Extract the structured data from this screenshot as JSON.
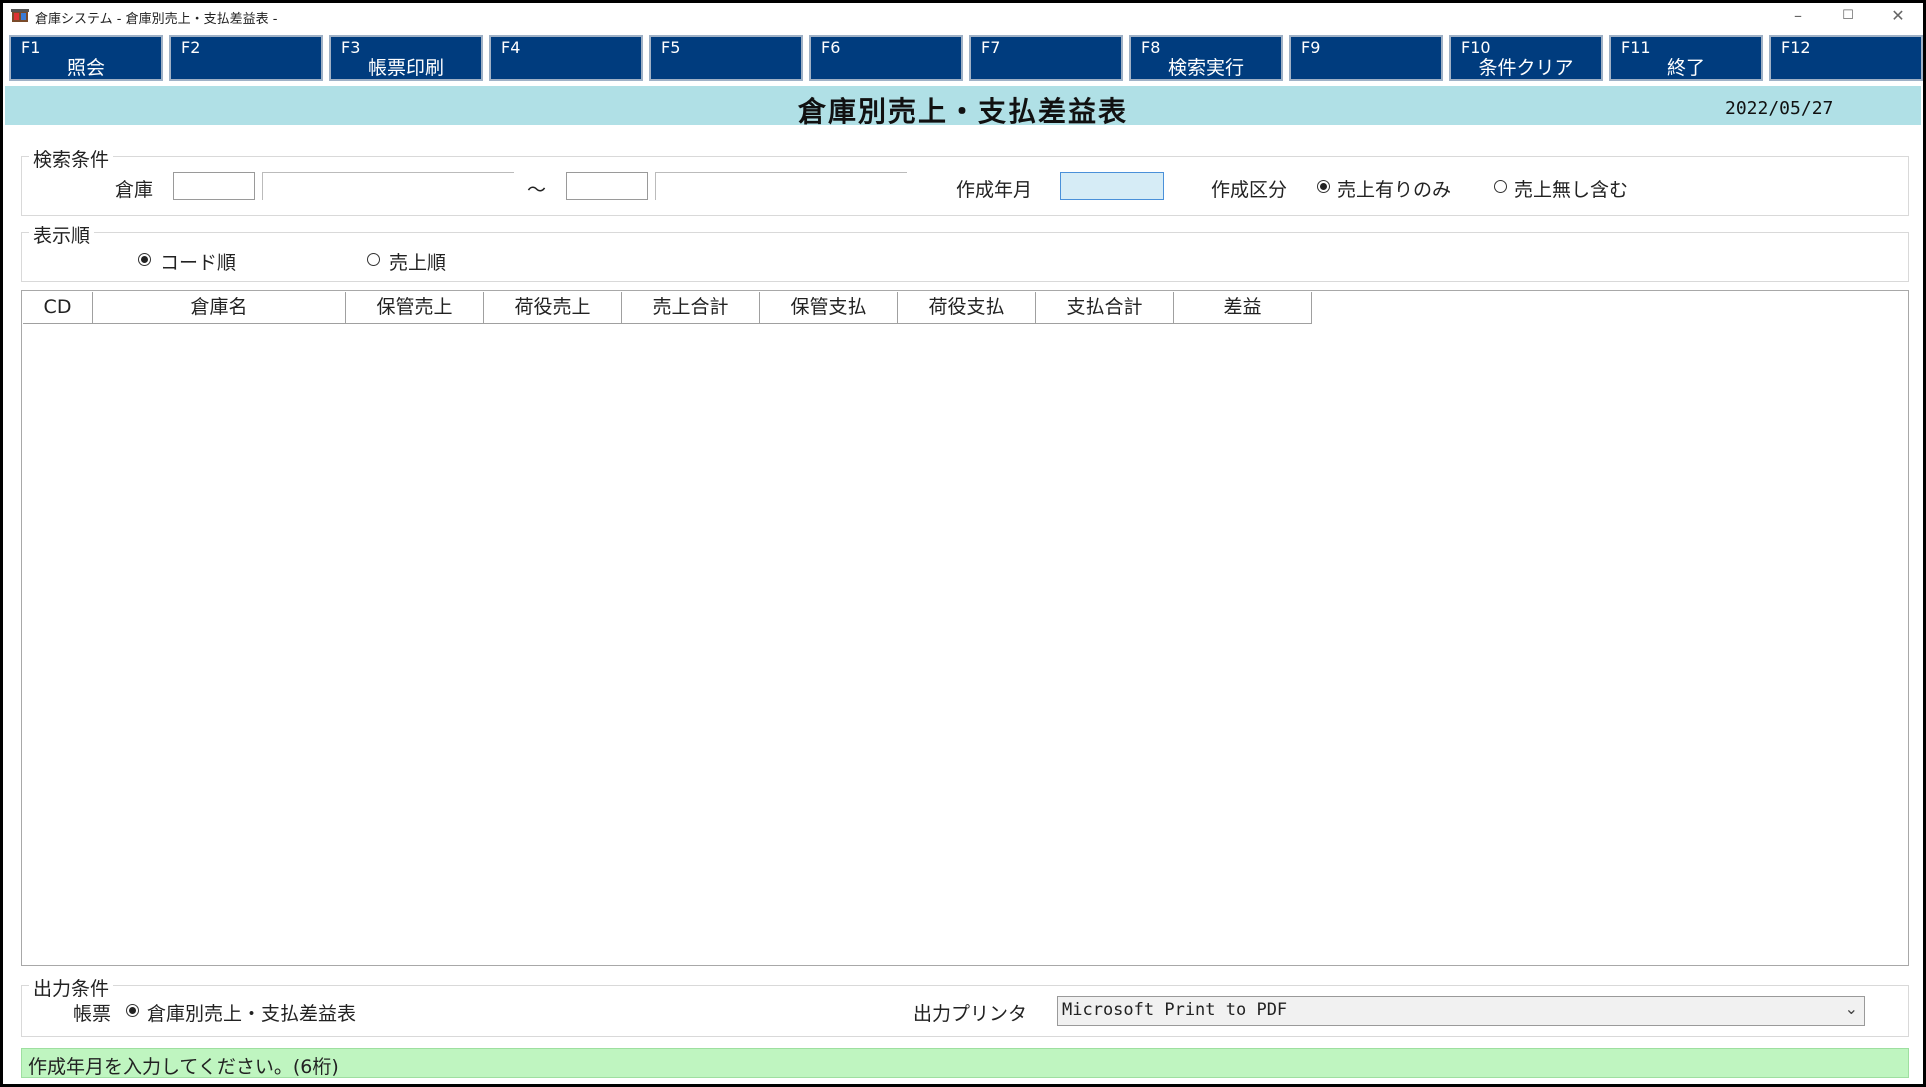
{
  "window": {
    "title": "倉庫システム - 倉庫別売上・支払差益表 -",
    "minimize": "–",
    "maximize": "☐",
    "close": "✕"
  },
  "function_keys": [
    {
      "key": "F1",
      "label": "照会"
    },
    {
      "key": "F2",
      "label": ""
    },
    {
      "key": "F3",
      "label": "帳票印刷"
    },
    {
      "key": "F4",
      "label": ""
    },
    {
      "key": "F5",
      "label": ""
    },
    {
      "key": "F6",
      "label": ""
    },
    {
      "key": "F7",
      "label": ""
    },
    {
      "key": "F8",
      "label": "検索実行"
    },
    {
      "key": "F9",
      "label": ""
    },
    {
      "key": "F10",
      "label": "条件クリア"
    },
    {
      "key": "F11",
      "label": "終了"
    },
    {
      "key": "F12",
      "label": ""
    }
  ],
  "header": {
    "title": "倉庫別売上・支払差益表",
    "date": "2022/05/27"
  },
  "search": {
    "group_title": "検索条件",
    "warehouse_label": "倉庫",
    "range_separator": "～",
    "warehouse_from_code": "",
    "warehouse_from_name": "",
    "warehouse_to_code": "",
    "warehouse_to_name": "",
    "month_label": "作成年月",
    "month_value": "",
    "kind_label": "作成区分",
    "kind_options": [
      {
        "label": "売上有りのみ",
        "selected": true
      },
      {
        "label": "売上無し含む",
        "selected": false
      }
    ]
  },
  "display_order": {
    "group_title": "表示順",
    "options": [
      {
        "label": "コード順",
        "selected": true
      },
      {
        "label": "売上順",
        "selected": false
      }
    ]
  },
  "grid": {
    "columns": [
      "CD",
      "倉庫名",
      "保管売上",
      "荷役売上",
      "売上合計",
      "保管支払",
      "荷役支払",
      "支払合計",
      "差益"
    ],
    "rows": []
  },
  "output": {
    "group_title": "出力条件",
    "report_label": "帳票",
    "report_option": "倉庫別売上・支払差益表",
    "report_selected": true,
    "printer_label": "出力プリンタ",
    "printer_value": "Microsoft Print to PDF",
    "printer_arrow": "⌄"
  },
  "status": {
    "message": "作成年月を入力してください。(6桁)"
  },
  "colors": {
    "fkey_bg": "#003c7e",
    "header_bg": "#b0e0e6",
    "status_bg": "#bff5c0",
    "month_input_bg": "#d6ecf6"
  }
}
